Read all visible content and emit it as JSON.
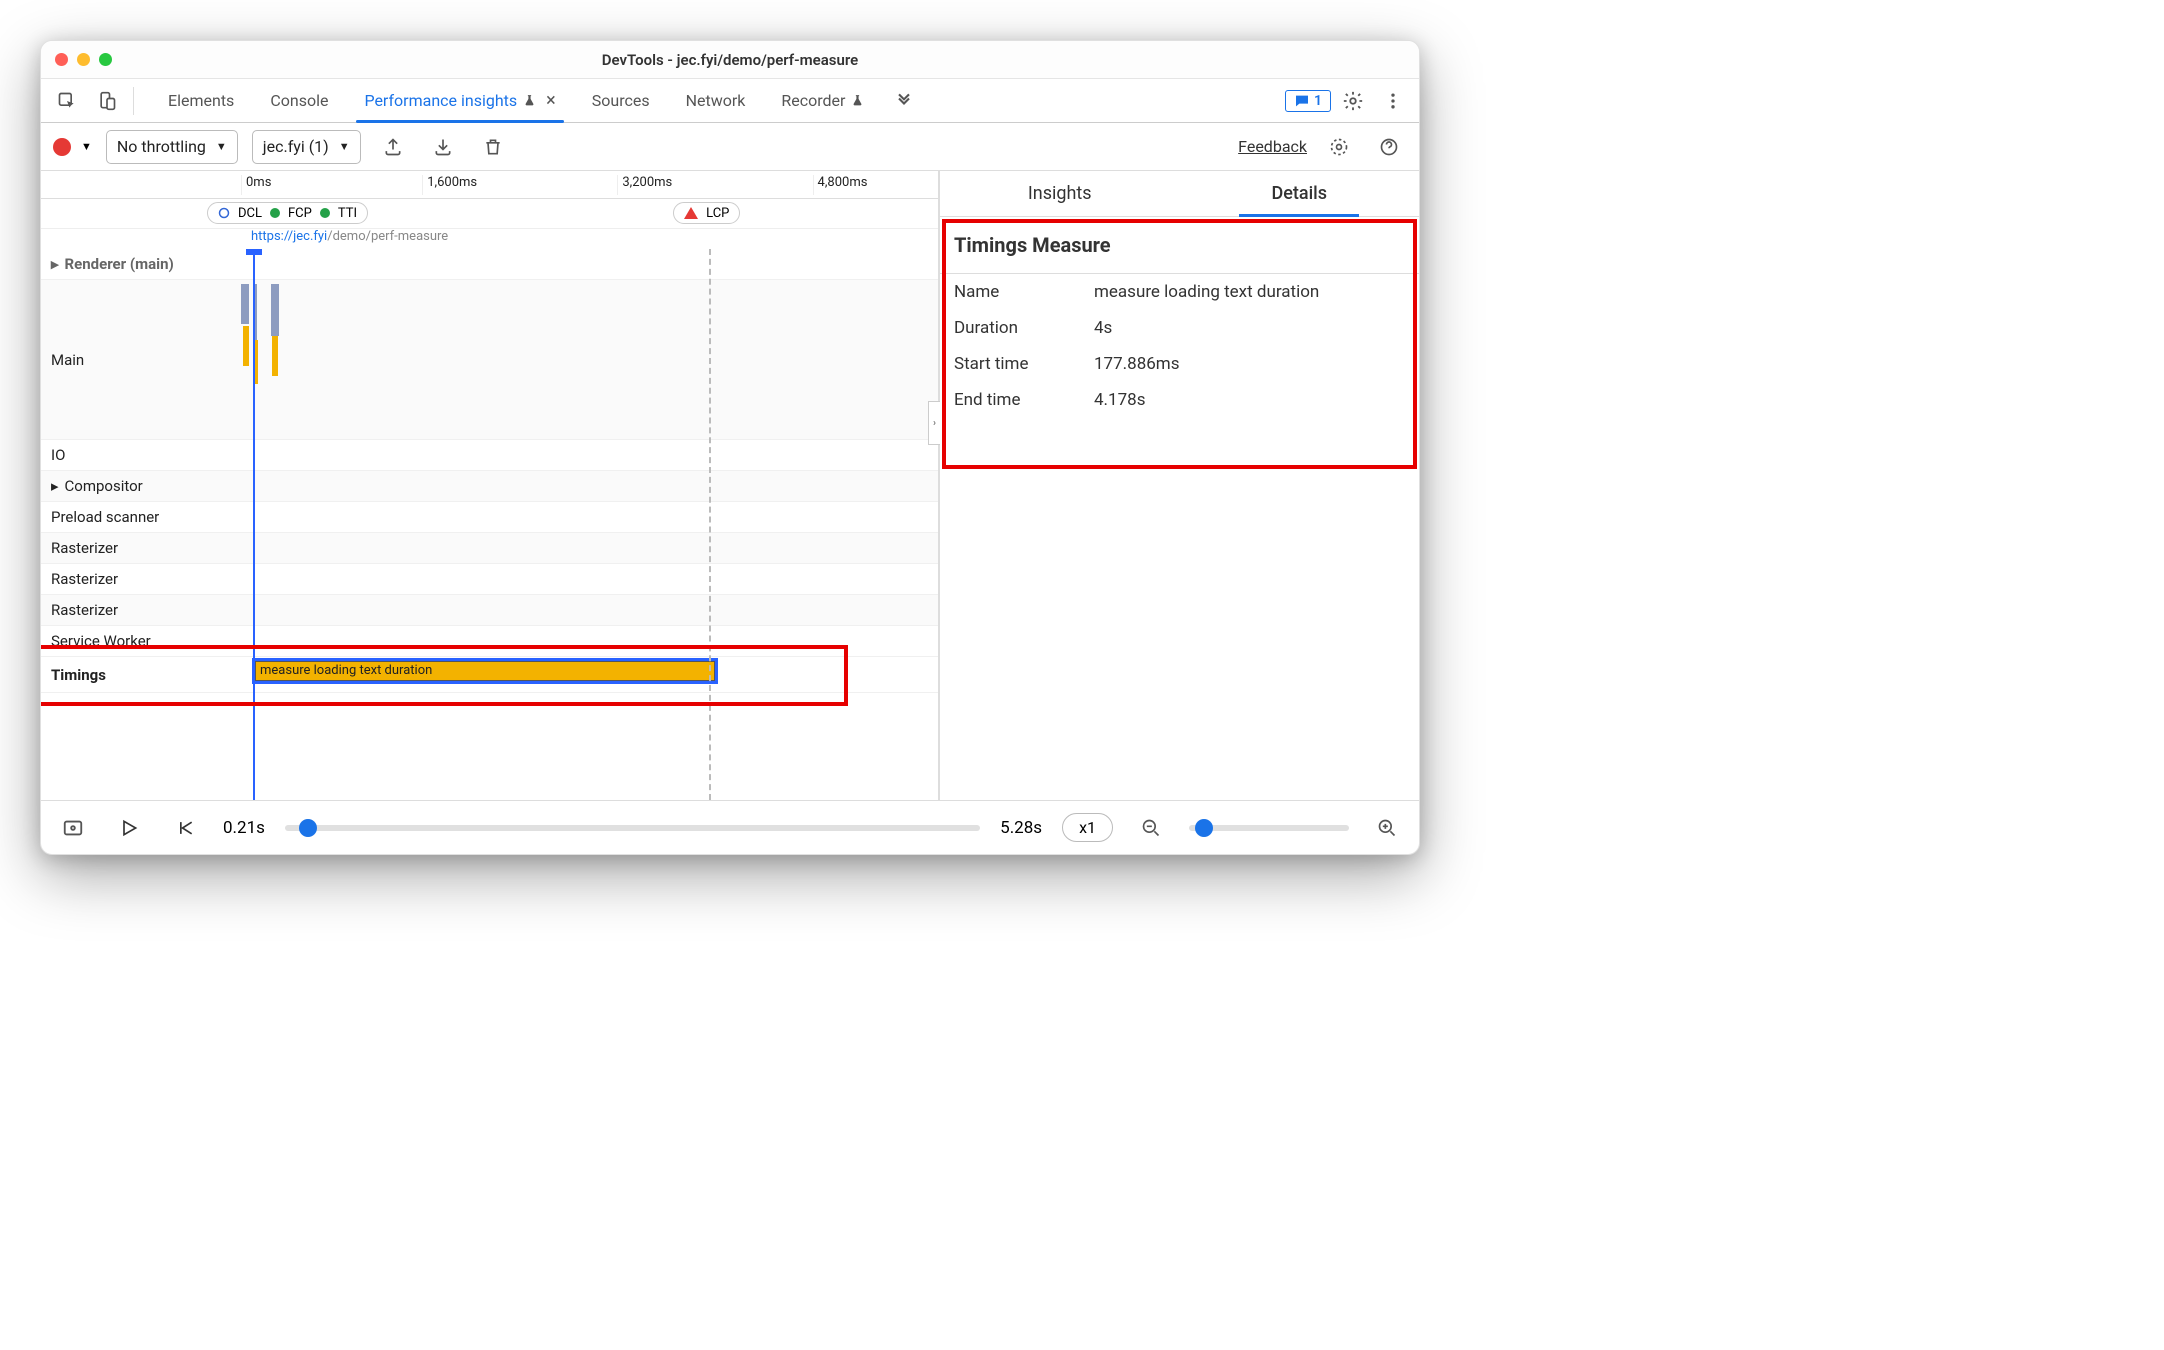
{
  "window": {
    "title": "DevTools - jec.fyi/demo/perf-measure"
  },
  "tabs": {
    "elements": "Elements",
    "console": "Console",
    "perf": "Performance insights",
    "sources": "Sources",
    "network": "Network",
    "recorder": "Recorder",
    "badge_count": "1"
  },
  "toolbar": {
    "throttling": "No throttling",
    "recording": "jec.fyi (1)",
    "feedback": "Feedback"
  },
  "ruler": {
    "t0": "0ms",
    "t1": "1,600ms",
    "t2": "3,200ms",
    "t3": "4,800ms"
  },
  "markers": {
    "dcl": "DCL",
    "fcp": "FCP",
    "tti": "TTI",
    "lcp": "LCP"
  },
  "url_strip": "https://jec.fyi/demo/perf-measure",
  "tracks": {
    "renderer": "Renderer (main)",
    "main": "Main",
    "io": "IO",
    "compositor": "Compositor",
    "preload": "Preload scanner",
    "raster": "Rasterizer",
    "sw": "Service Worker",
    "timings": "Timings",
    "timing_bar": "measure loading text duration"
  },
  "side": {
    "insights": "Insights",
    "details": "Details",
    "section": "Timings Measure",
    "name_k": "Name",
    "name_v": "measure loading text duration",
    "dur_k": "Duration",
    "dur_v": "4s",
    "start_k": "Start time",
    "start_v": "177.886ms",
    "end_k": "End time",
    "end_v": "4.178s"
  },
  "footer": {
    "t_start": "0.21s",
    "t_end": "5.28s",
    "speed": "x1"
  }
}
